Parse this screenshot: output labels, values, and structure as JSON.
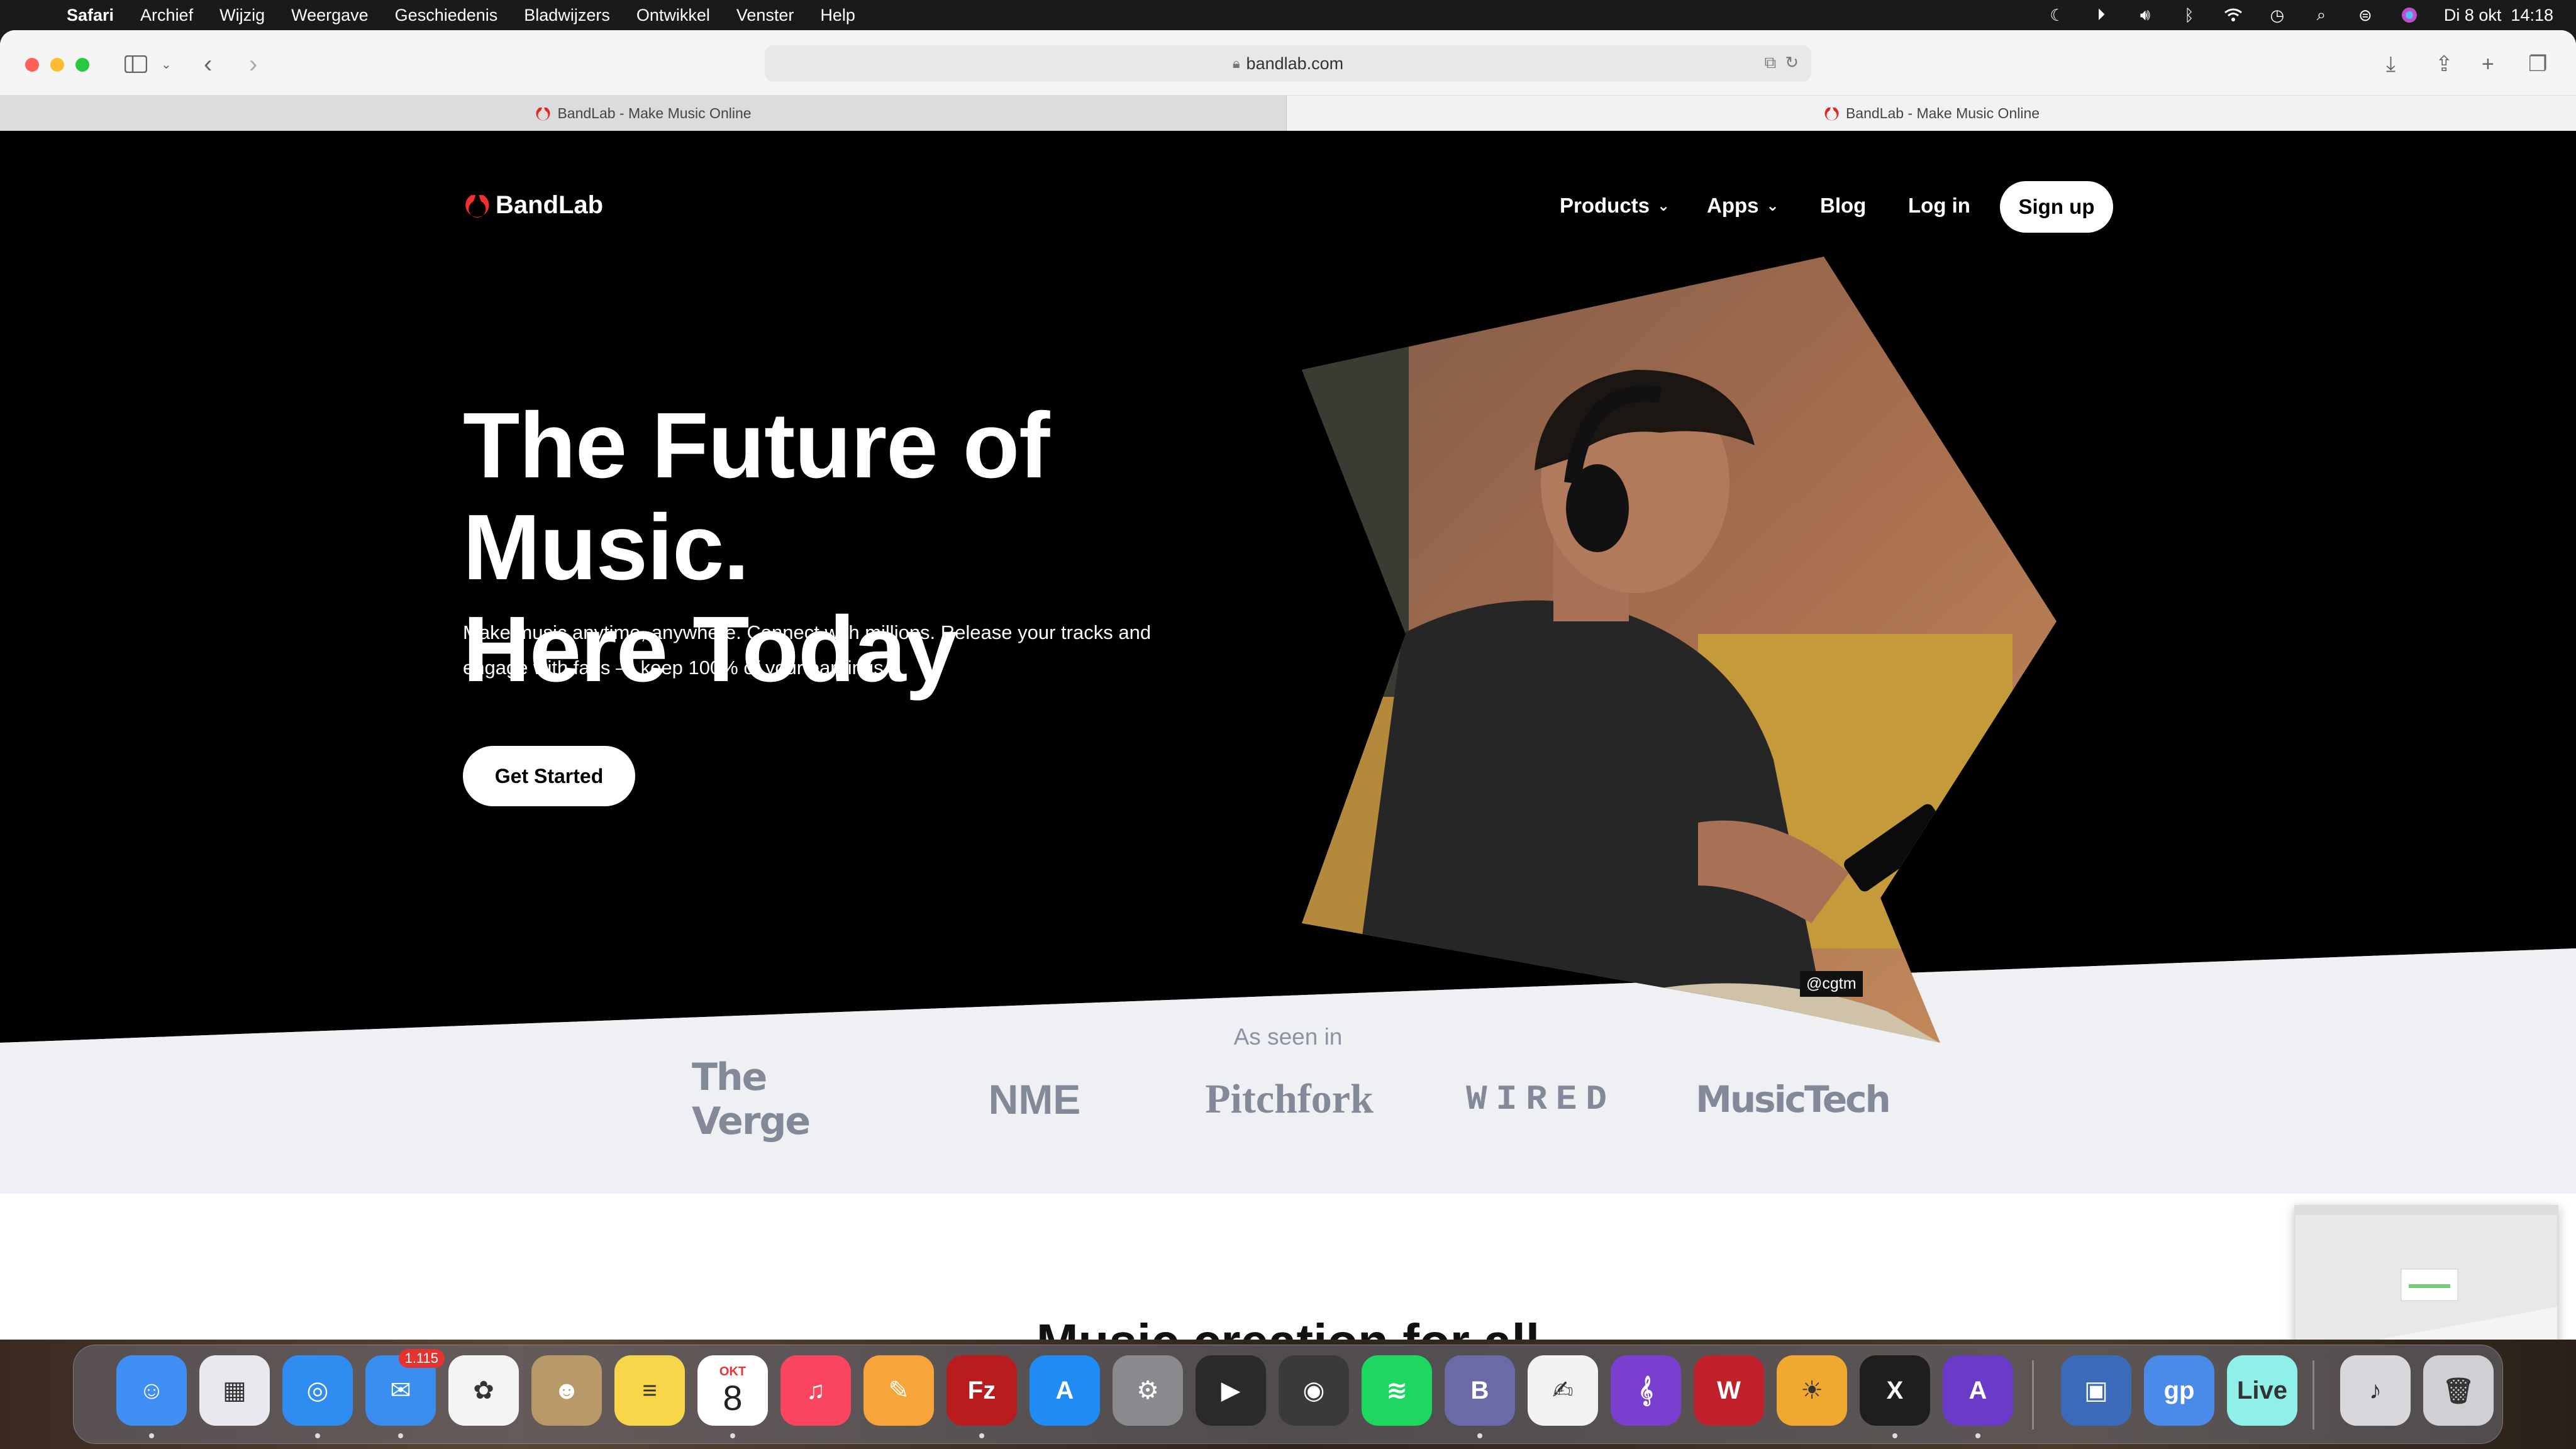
{
  "menubar": {
    "app": "Safari",
    "items": [
      "Archief",
      "Wijzig",
      "Weergave",
      "Geschiedenis",
      "Bladwijzers",
      "Ontwikkel",
      "Venster",
      "Help"
    ],
    "clock": "Di 8 okt  14:18",
    "status_icons": [
      "moon-icon",
      "play-icon",
      "volume-icon",
      "bluetooth-icon",
      "wifi-icon",
      "time-machine-icon",
      "search-icon",
      "control-center-icon",
      "siri-icon"
    ]
  },
  "browser": {
    "url": "bandlab.com",
    "tabs": [
      {
        "label": "BandLab - Make Music Online",
        "active": false
      },
      {
        "label": "BandLab - Make Music Online",
        "active": true
      }
    ]
  },
  "site": {
    "brand": "BandLab",
    "nav": {
      "products": "Products",
      "apps": "Apps",
      "blog": "Blog",
      "login": "Log in",
      "signup": "Sign up"
    },
    "hero": {
      "title": "The Future of Music.\nHere Today",
      "subtitle": "Make music anytime, anywhere. Connect with millions. Release your tracks and engage with fans — keep 100% of your earnings.",
      "cta": "Get Started",
      "photo_credit": "@cgtm"
    },
    "press": {
      "label": "As seen in",
      "logos": [
        "The Verge",
        "NME",
        "Pitchfork",
        "WIRED",
        "MusicTech"
      ]
    },
    "next_heading": "Music creation for all"
  },
  "dock": {
    "apps": [
      {
        "name": "Finder",
        "color": "#3f8ff5"
      },
      {
        "name": "Launchpad",
        "color": "#e8e8ee"
      },
      {
        "name": "Safari",
        "color": "#2f8cf0"
      },
      {
        "name": "Mail",
        "color": "#3a8ef0",
        "badge": "1.115"
      },
      {
        "name": "Photos",
        "color": "#f4f4f4"
      },
      {
        "name": "Contacts",
        "color": "#b89a6a"
      },
      {
        "name": "Notes",
        "color": "#f8d64a"
      },
      {
        "name": "Calendar",
        "color": "#ffffff",
        "month": "OKT",
        "day": "8"
      },
      {
        "name": "Music",
        "color": "#f94560"
      },
      {
        "name": "Pages",
        "color": "#f7a43a"
      },
      {
        "name": "FileZilla",
        "color": "#b91c1c"
      },
      {
        "name": "App Store",
        "color": "#1f8cf5"
      },
      {
        "name": "System Settings",
        "color": "#8a8a8e"
      },
      {
        "name": "Final Cut Pro",
        "color": "#2a2a2a"
      },
      {
        "name": "Logic Pro",
        "color": "#3a3a3a"
      },
      {
        "name": "Spotify",
        "color": "#1ed760"
      },
      {
        "name": "BBEdit",
        "color": "#6a6aa8"
      },
      {
        "name": "TextEdit",
        "color": "#f2f2f2"
      },
      {
        "name": "Notation",
        "color": "#7b3fd0"
      },
      {
        "name": "Waves",
        "color": "#c0202a"
      },
      {
        "name": "Sunny",
        "color": "#f0a830"
      },
      {
        "name": "X32 Edit",
        "color": "#1e1e1e"
      },
      {
        "name": "Affinity",
        "color": "#6a3ac8"
      },
      {
        "name": "Preview",
        "color": "#3a6ab8"
      },
      {
        "name": "Guitar Pro",
        "color": "#4a8ae8"
      },
      {
        "name": "Live",
        "color": "#8ff0e8"
      },
      {
        "name": "Music Folder",
        "color": "#d8d8dc"
      },
      {
        "name": "Trash",
        "color": "#cfcfd4"
      }
    ]
  }
}
